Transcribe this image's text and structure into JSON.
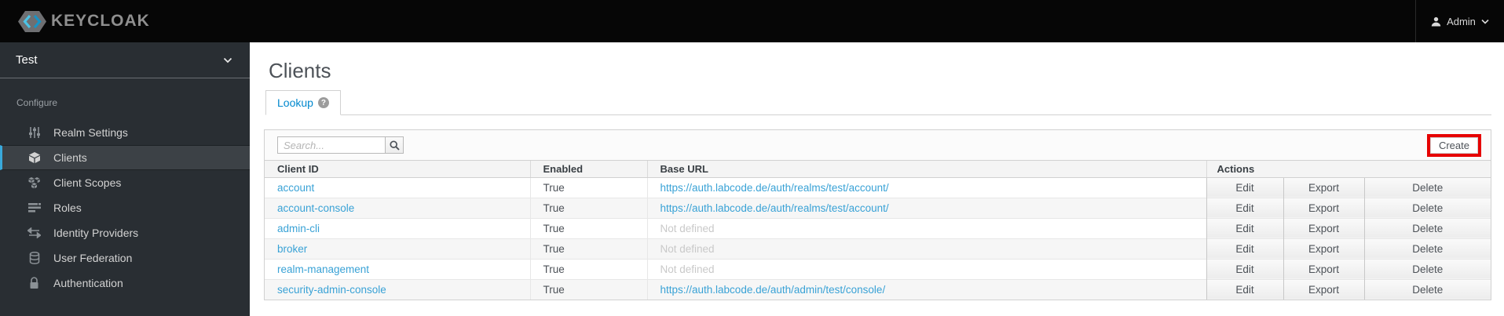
{
  "header": {
    "logo_text": "KEYCLOAK",
    "user_label": "Admin",
    "user_icon": "person-icon",
    "caret_icon": "chevron-down-icon"
  },
  "sidebar": {
    "realm_name": "Test",
    "realm_caret_icon": "chevron-down-icon",
    "section_label": "Configure",
    "items": [
      {
        "label": "Realm Settings",
        "icon": "sliders-icon",
        "selected": false
      },
      {
        "label": "Clients",
        "icon": "cube-icon",
        "selected": true
      },
      {
        "label": "Client Scopes",
        "icon": "cubes-icon",
        "selected": false
      },
      {
        "label": "Roles",
        "icon": "list-icon",
        "selected": false
      },
      {
        "label": "Identity Providers",
        "icon": "exchange-icon",
        "selected": false
      },
      {
        "label": "User Federation",
        "icon": "database-icon",
        "selected": false
      },
      {
        "label": "Authentication",
        "icon": "lock-icon",
        "selected": false
      }
    ]
  },
  "main": {
    "title": "Clients",
    "tab": {
      "label": "Lookup",
      "help_icon": "question-circle-icon",
      "help_glyph": "?"
    },
    "toolbar": {
      "search_placeholder": "Search...",
      "search_icon": "magnifier-icon",
      "create_label": "Create",
      "create_highlight_color": "#e60000"
    },
    "table": {
      "columns": [
        "Client ID",
        "Enabled",
        "Base URL",
        "Actions"
      ],
      "action_labels": [
        "Edit",
        "Export",
        "Delete"
      ],
      "rows": [
        {
          "client_id": "account",
          "enabled": "True",
          "base_url": "https://auth.labcode.de/auth/realms/test/account/",
          "url_is_link": true
        },
        {
          "client_id": "account-console",
          "enabled": "True",
          "base_url": "https://auth.labcode.de/auth/realms/test/account/",
          "url_is_link": true
        },
        {
          "client_id": "admin-cli",
          "enabled": "True",
          "base_url": "Not defined",
          "url_is_link": false
        },
        {
          "client_id": "broker",
          "enabled": "True",
          "base_url": "Not defined",
          "url_is_link": false
        },
        {
          "client_id": "realm-management",
          "enabled": "True",
          "base_url": "Not defined",
          "url_is_link": false
        },
        {
          "client_id": "security-admin-console",
          "enabled": "True",
          "base_url": "https://auth.labcode.de/auth/admin/test/console/",
          "url_is_link": true
        }
      ]
    }
  },
  "colors": {
    "masthead_bg": "#060606",
    "sidebar_bg": "#292e33",
    "selected_accent": "#39a9dc",
    "link_blue": "#39a2d6",
    "tab_blue": "#0088ce",
    "highlight_red": "#e60000"
  }
}
